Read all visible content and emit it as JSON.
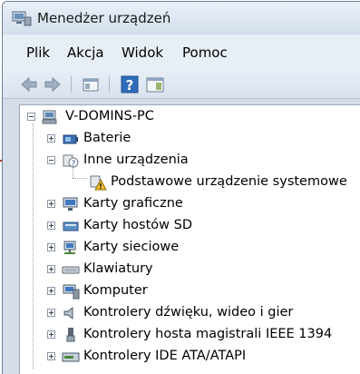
{
  "window": {
    "title": "Menedżer urządzeń"
  },
  "menu": {
    "file": "Plik",
    "action": "Akcja",
    "view": "Widok",
    "help": "Pomoc"
  },
  "toolbar": {
    "icons": [
      "back-arrow-icon",
      "forward-arrow-icon",
      "properties-icon",
      "help-icon",
      "view-pane-icon"
    ]
  },
  "tree": {
    "root": "V-DOMINS-PC",
    "items": [
      {
        "label": "Baterie",
        "icon": "battery-icon"
      },
      {
        "label": "Inne urządzenia",
        "icon": "unknown-device-icon"
      },
      {
        "label": "Podstawowe urządzenie systemowe",
        "icon": "warning-device-icon"
      },
      {
        "label": "Karty graficzne",
        "icon": "display-adapter-icon"
      },
      {
        "label": "Karty hostów SD",
        "icon": "sd-host-icon"
      },
      {
        "label": "Karty sieciowe",
        "icon": "network-adapter-icon"
      },
      {
        "label": "Klawiatury",
        "icon": "keyboard-icon"
      },
      {
        "label": "Komputer",
        "icon": "computer-icon"
      },
      {
        "label": "Kontrolery dźwięku, wideo i gier",
        "icon": "speaker-icon"
      },
      {
        "label": "Kontrolery hosta magistrali IEEE 1394",
        "icon": "ieee1394-icon"
      },
      {
        "label": "Kontrolery IDE ATA/ATAPI",
        "icon": "ide-controller-icon"
      }
    ]
  },
  "colors": {
    "annotation_arrow": "#c0392b",
    "window_chrome": "#d4dde8"
  }
}
